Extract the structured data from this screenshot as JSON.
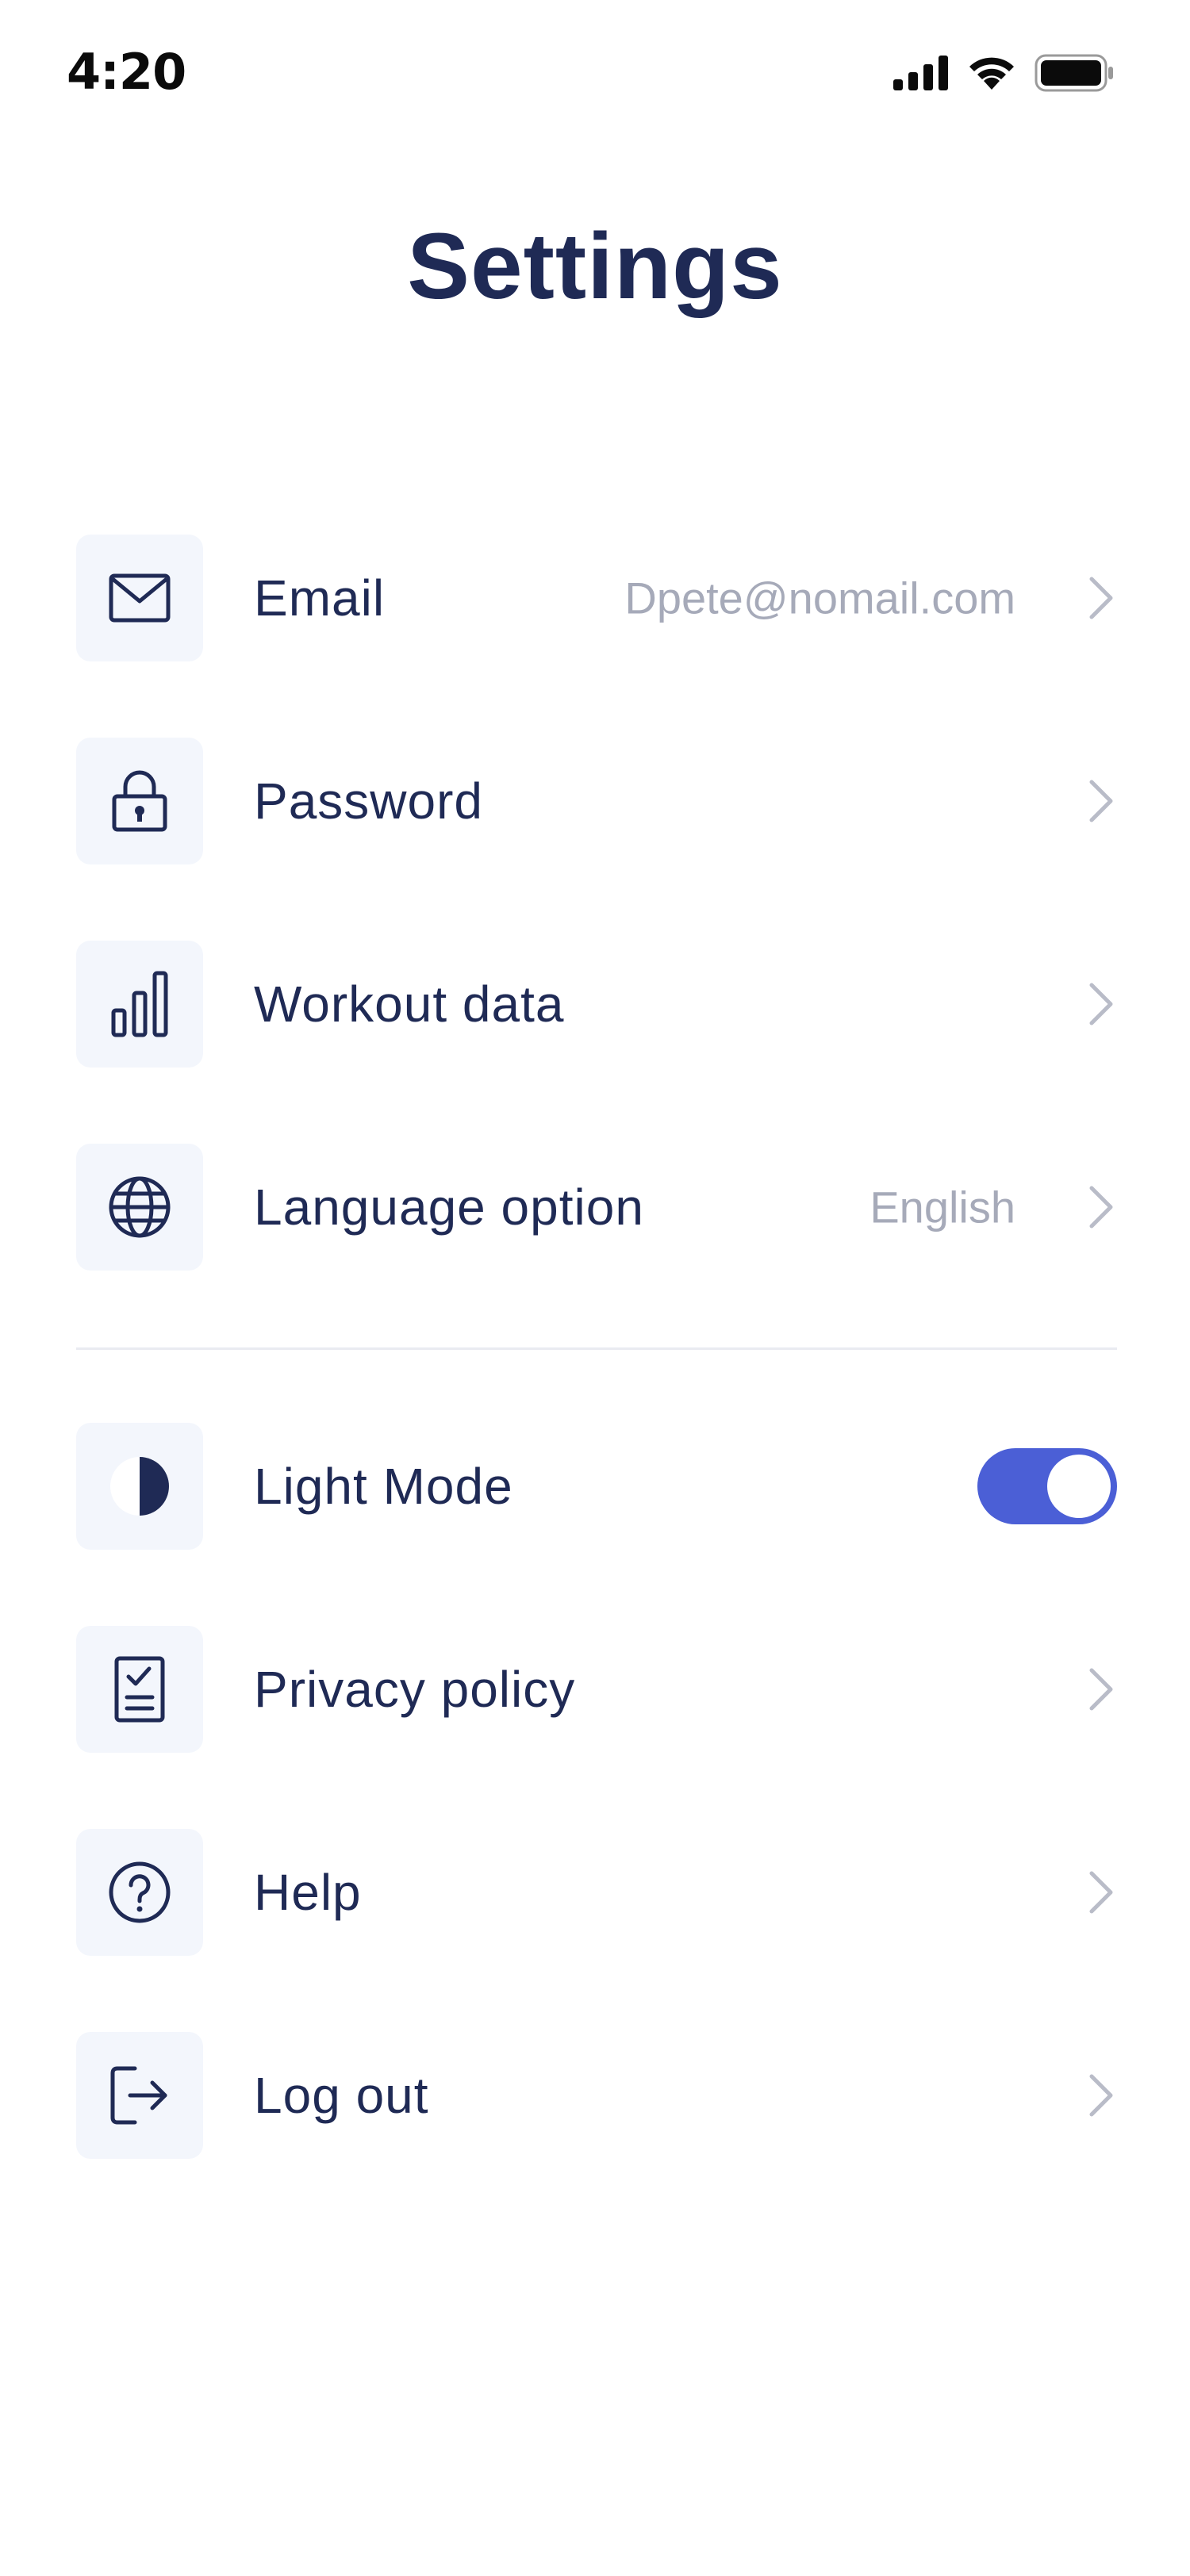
{
  "status_bar": {
    "time": "4:20"
  },
  "header": {
    "title": "Settings"
  },
  "settings": {
    "email": {
      "label": "Email",
      "value": "Dpete@nomail.com"
    },
    "password": {
      "label": "Password"
    },
    "workout": {
      "label": "Workout data"
    },
    "language": {
      "label": "Language option",
      "value": "English"
    },
    "light_mode": {
      "label": "Light Mode",
      "enabled": true
    },
    "privacy": {
      "label": "Privacy policy"
    },
    "help": {
      "label": "Help"
    },
    "logout": {
      "label": "Log out"
    }
  },
  "colors": {
    "primary_text": "#1f2a55",
    "secondary_text": "#a6aab9",
    "icon_tile": "#f3f6fc",
    "toggle_on": "#4b5fd6"
  },
  "icons": {
    "email": "mail-icon",
    "password": "lock-icon",
    "workout": "bar-chart-icon",
    "language": "globe-icon",
    "light_mode": "contrast-icon",
    "privacy": "document-check-icon",
    "help": "question-circle-icon",
    "logout": "logout-icon"
  }
}
